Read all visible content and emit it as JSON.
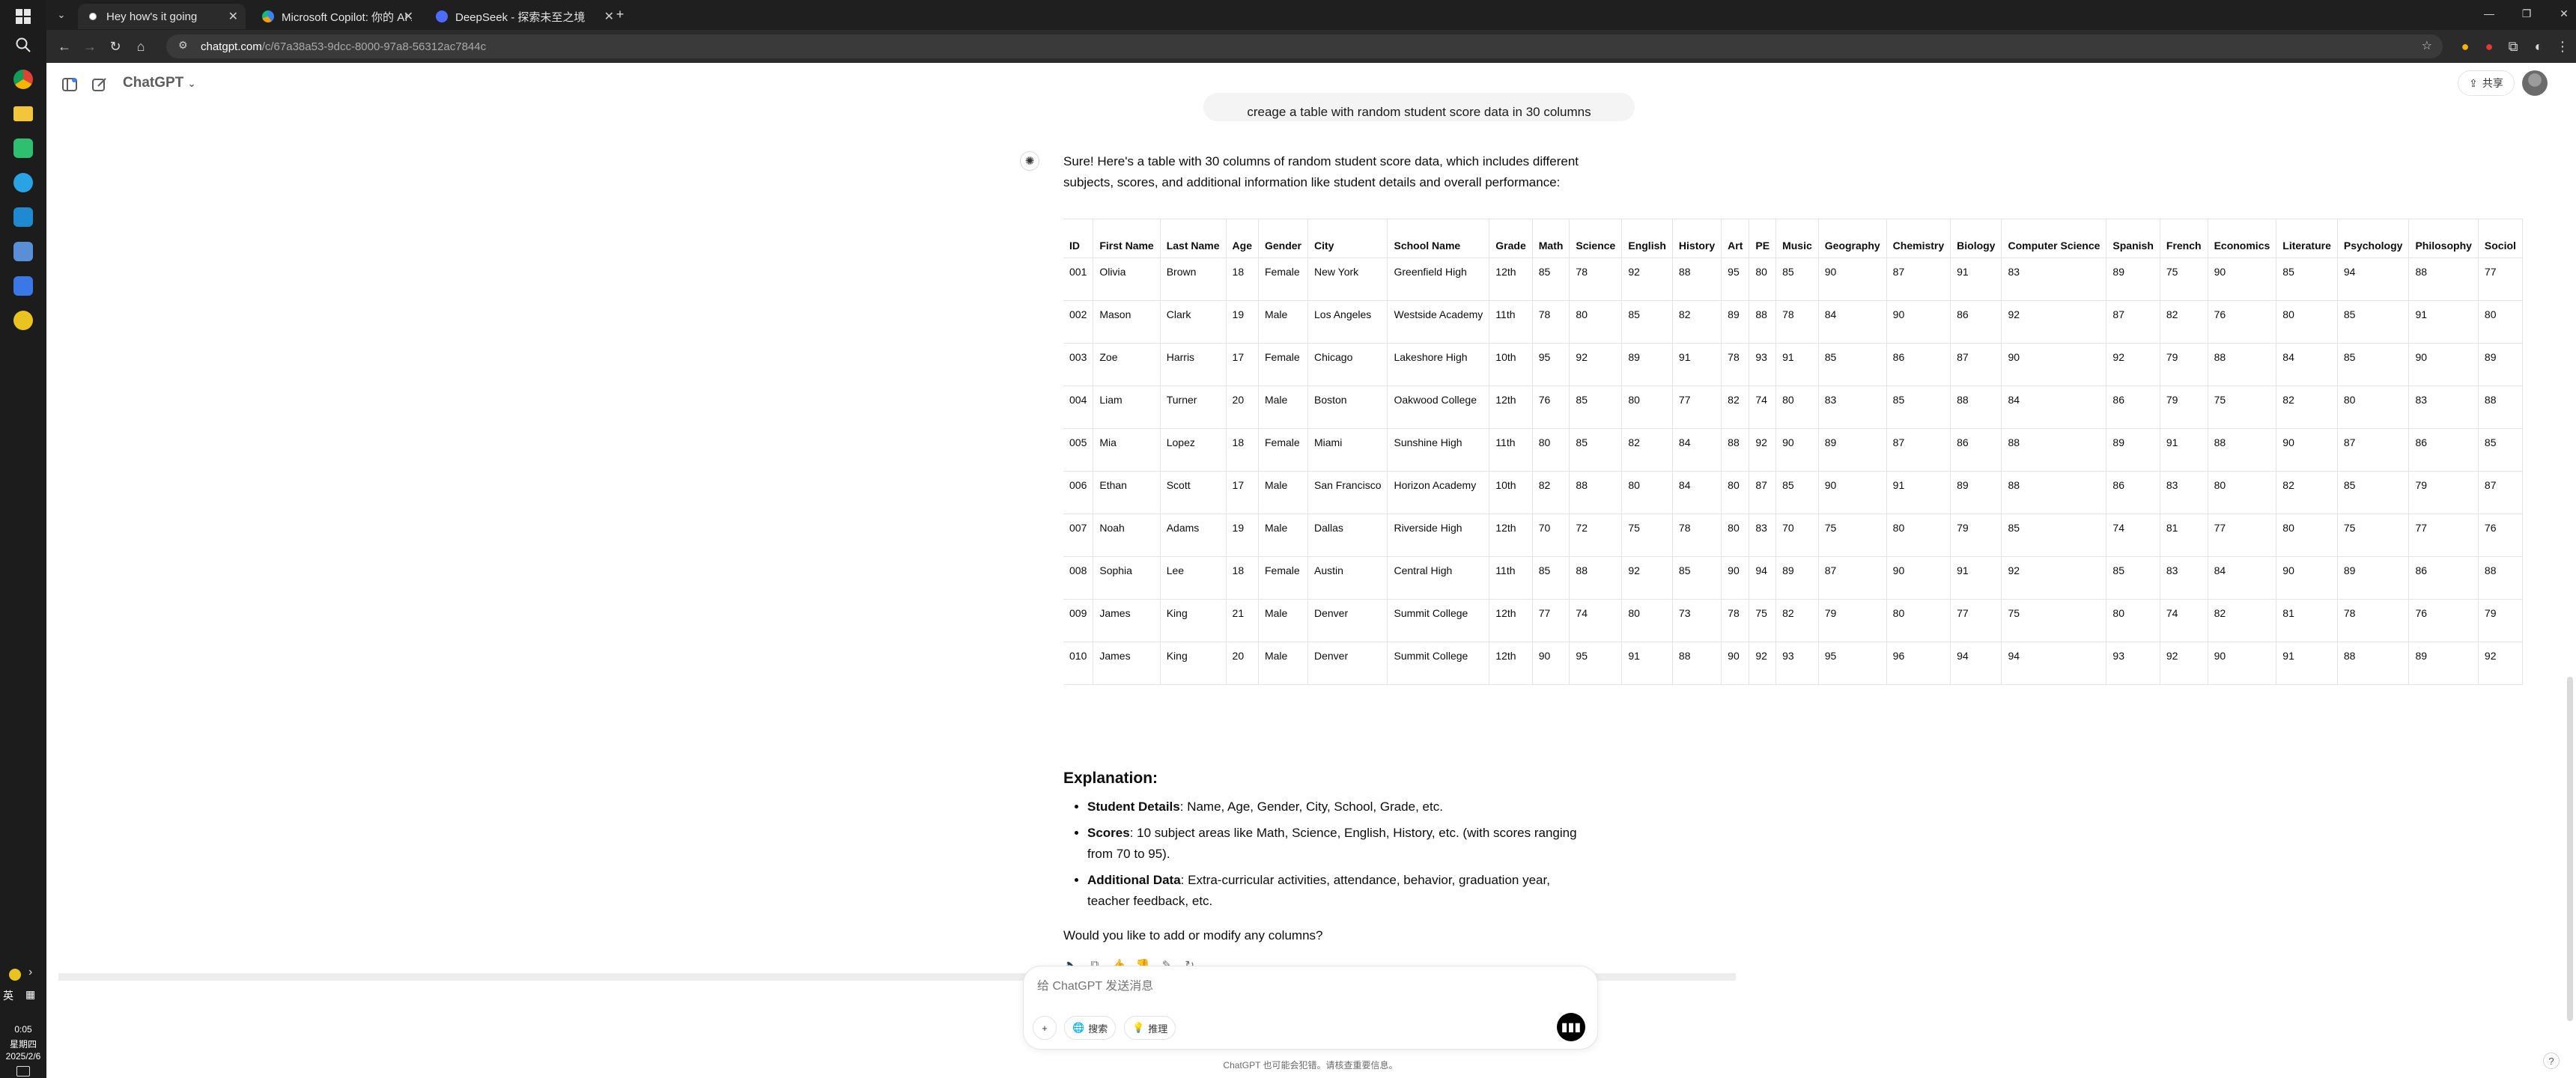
{
  "browser": {
    "tabs": [
      {
        "label": "Hey how's it going",
        "active": true
      },
      {
        "label": "Microsoft Copilot: 你的 AI 助",
        "active": false
      },
      {
        "label": "DeepSeek - 探索未至之境",
        "active": false
      }
    ],
    "url_host": "chatgpt.com",
    "url_path": "/c/67a38a53-9dcc-8000-97a8-56312ac7844c"
  },
  "taskbar": {
    "ime_lang": "英",
    "time": "0:05",
    "weekday": "星期四",
    "date": "2025/2/6"
  },
  "app": {
    "model_name": "ChatGPT",
    "share_label": "共享",
    "user_message": "creage a table with random student score data in 30 columns",
    "assistant_intro": "Sure! Here's a table with 30 columns of random student score data, which includes different subjects, scores, and additional information like student details and overall performance:",
    "explanation_title": "Explanation:",
    "bullets": [
      {
        "bold": "Student Details",
        "text": ": Name, Age, Gender, City, School, Grade, etc."
      },
      {
        "bold": "Scores",
        "text": ": 10 subject areas like Math, Science, English, History, etc. (with scores ranging from 70 to 95)."
      },
      {
        "bold": "Additional Data",
        "text": ": Extra-curricular activities, attendance, behavior, graduation year, teacher feedback, etc."
      }
    ],
    "question": "Would you like to add or modify any columns?",
    "composer_placeholder": "给 ChatGPT 发送消息",
    "search_label": "搜索",
    "reason_label": "推理",
    "disclaimer": "ChatGPT 也可能会犯错。请核查重要信息。",
    "help": "?"
  },
  "table": {
    "headers": [
      "ID",
      "First Name",
      "Last Name",
      "Age",
      "Gender",
      "City",
      "School Name",
      "Grade",
      "Math",
      "Science",
      "English",
      "History",
      "Art",
      "PE",
      "Music",
      "Geography",
      "Chemistry",
      "Biology",
      "Computer Science",
      "Spanish",
      "French",
      "Economics",
      "Literature",
      "Psychology",
      "Philosophy",
      "Sociol"
    ],
    "rows": [
      [
        "001",
        "Olivia",
        "Brown",
        "18",
        "Female",
        "New York",
        "Greenfield High",
        "12th",
        "85",
        "78",
        "92",
        "88",
        "95",
        "80",
        "85",
        "90",
        "87",
        "91",
        "83",
        "89",
        "75",
        "90",
        "85",
        "94",
        "88",
        "77"
      ],
      [
        "002",
        "Mason",
        "Clark",
        "19",
        "Male",
        "Los Angeles",
        "Westside Academy",
        "11th",
        "78",
        "80",
        "85",
        "82",
        "89",
        "88",
        "78",
        "84",
        "90",
        "86",
        "92",
        "87",
        "82",
        "76",
        "80",
        "85",
        "91",
        "80"
      ],
      [
        "003",
        "Zoe",
        "Harris",
        "17",
        "Female",
        "Chicago",
        "Lakeshore High",
        "10th",
        "95",
        "92",
        "89",
        "91",
        "78",
        "93",
        "91",
        "85",
        "86",
        "87",
        "90",
        "92",
        "79",
        "88",
        "84",
        "85",
        "90",
        "89"
      ],
      [
        "004",
        "Liam",
        "Turner",
        "20",
        "Male",
        "Boston",
        "Oakwood College",
        "12th",
        "76",
        "85",
        "80",
        "77",
        "82",
        "74",
        "80",
        "83",
        "85",
        "88",
        "84",
        "86",
        "79",
        "75",
        "82",
        "80",
        "83",
        "88"
      ],
      [
        "005",
        "Mia",
        "Lopez",
        "18",
        "Female",
        "Miami",
        "Sunshine High",
        "11th",
        "80",
        "85",
        "82",
        "84",
        "88",
        "92",
        "90",
        "89",
        "87",
        "86",
        "88",
        "89",
        "91",
        "88",
        "90",
        "87",
        "86",
        "85"
      ],
      [
        "006",
        "Ethan",
        "Scott",
        "17",
        "Male",
        "San Francisco",
        "Horizon Academy",
        "10th",
        "82",
        "88",
        "80",
        "84",
        "80",
        "87",
        "85",
        "90",
        "91",
        "89",
        "88",
        "86",
        "83",
        "80",
        "82",
        "85",
        "79",
        "87"
      ],
      [
        "007",
        "Noah",
        "Adams",
        "19",
        "Male",
        "Dallas",
        "Riverside High",
        "12th",
        "70",
        "72",
        "75",
        "78",
        "80",
        "83",
        "70",
        "75",
        "80",
        "79",
        "85",
        "74",
        "81",
        "77",
        "80",
        "75",
        "77",
        "76"
      ],
      [
        "008",
        "Sophia",
        "Lee",
        "18",
        "Female",
        "Austin",
        "Central High",
        "11th",
        "85",
        "88",
        "92",
        "85",
        "90",
        "94",
        "89",
        "87",
        "90",
        "91",
        "92",
        "85",
        "83",
        "84",
        "90",
        "89",
        "86",
        "88"
      ],
      [
        "009",
        "James",
        "King",
        "21",
        "Male",
        "Denver",
        "Summit College",
        "12th",
        "77",
        "74",
        "80",
        "73",
        "78",
        "75",
        "82",
        "79",
        "80",
        "77",
        "75",
        "80",
        "74",
        "82",
        "81",
        "78",
        "76",
        "79"
      ],
      [
        "010",
        "James",
        "King",
        "20",
        "Male",
        "Denver",
        "Summit College",
        "12th",
        "90",
        "95",
        "91",
        "88",
        "90",
        "92",
        "93",
        "95",
        "96",
        "94",
        "94",
        "93",
        "92",
        "90",
        "91",
        "88",
        "89",
        "92"
      ]
    ]
  },
  "colors": {
    "taskbar_bg": "#1c1c1c",
    "tabstrip_bg": "#1f1f1f",
    "toolbar_bg": "#2b2b2b",
    "voice_button": "#000000"
  }
}
